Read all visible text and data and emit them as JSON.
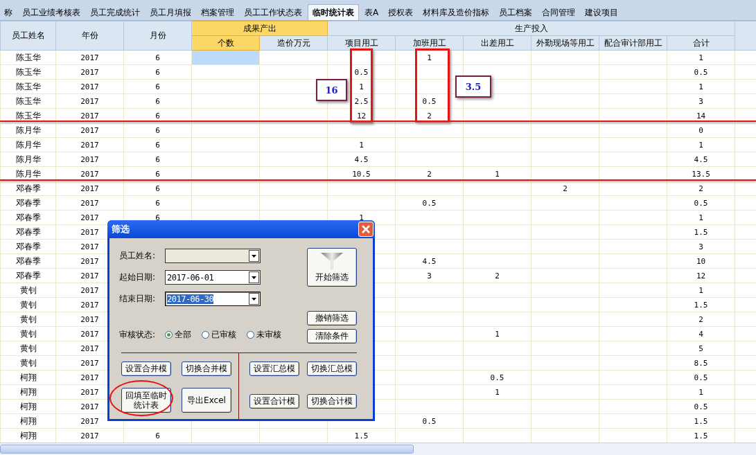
{
  "tabs": [
    {
      "label": "称",
      "selected": false
    },
    {
      "label": "员工业绩考核表",
      "selected": false
    },
    {
      "label": "员工完成统计",
      "selected": false
    },
    {
      "label": "员工月填报",
      "selected": false
    },
    {
      "label": "档案管理",
      "selected": false
    },
    {
      "label": "员工工作状态表",
      "selected": false
    },
    {
      "label": "临时统计表",
      "selected": true
    },
    {
      "label": "表A",
      "selected": false
    },
    {
      "label": "授权表",
      "selected": false
    },
    {
      "label": "材料库及造价指标",
      "selected": false
    },
    {
      "label": "员工档案",
      "selected": false
    },
    {
      "label": "合同管理",
      "selected": false
    },
    {
      "label": "建设项目",
      "selected": false
    }
  ],
  "table": {
    "groups": [
      {
        "label": "成果产出",
        "selected": true
      },
      {
        "label": "生产投入",
        "selected": false
      }
    ],
    "columns": [
      {
        "label": "员工姓名",
        "selected": false
      },
      {
        "label": "年份",
        "selected": false
      },
      {
        "label": "月份",
        "selected": false
      },
      {
        "label": "个数",
        "selected": true
      },
      {
        "label": "造价万元",
        "selected": false
      },
      {
        "label": "项目用工",
        "selected": false
      },
      {
        "label": "加班用工",
        "selected": false
      },
      {
        "label": "出差用工",
        "selected": false
      },
      {
        "label": "外勤现场等用工",
        "selected": false
      },
      {
        "label": "配合审计部用工",
        "selected": false
      },
      {
        "label": "合计",
        "selected": false
      }
    ],
    "rows": [
      {
        "selected": true,
        "cells": [
          "陈玉华",
          "2017",
          "6",
          null,
          null,
          null,
          "1",
          null,
          null,
          null,
          "1"
        ]
      },
      {
        "selected": false,
        "cells": [
          "陈玉华",
          "2017",
          "6",
          null,
          null,
          "0.5",
          null,
          null,
          null,
          null,
          "0.5"
        ]
      },
      {
        "selected": false,
        "cells": [
          "陈玉华",
          "2017",
          "6",
          null,
          null,
          "1",
          null,
          null,
          null,
          null,
          "1"
        ]
      },
      {
        "selected": false,
        "cells": [
          "陈玉华",
          "2017",
          "6",
          null,
          null,
          "2.5",
          "0.5",
          null,
          null,
          null,
          "3"
        ]
      },
      {
        "selected": false,
        "cells": [
          "陈玉华",
          "2017",
          "6",
          null,
          null,
          "12",
          "2",
          null,
          null,
          null,
          "14"
        ]
      },
      {
        "selected": false,
        "cells": [
          "陈月华",
          "2017",
          "6",
          null,
          null,
          null,
          null,
          null,
          null,
          null,
          "0"
        ]
      },
      {
        "selected": false,
        "cells": [
          "陈月华",
          "2017",
          "6",
          null,
          null,
          "1",
          null,
          null,
          null,
          null,
          "1"
        ]
      },
      {
        "selected": false,
        "cells": [
          "陈月华",
          "2017",
          "6",
          null,
          null,
          "4.5",
          null,
          null,
          null,
          null,
          "4.5"
        ]
      },
      {
        "selected": false,
        "cells": [
          "陈月华",
          "2017",
          "6",
          null,
          null,
          "10.5",
          "2",
          "1",
          null,
          null,
          "13.5"
        ]
      },
      {
        "selected": false,
        "cells": [
          "邓春季",
          "2017",
          "6",
          null,
          null,
          null,
          null,
          null,
          "2",
          null,
          "2"
        ]
      },
      {
        "selected": false,
        "cells": [
          "邓春季",
          "2017",
          "6",
          null,
          null,
          null,
          "0.5",
          null,
          null,
          null,
          "0.5"
        ]
      },
      {
        "selected": false,
        "cells": [
          "邓春季",
          "2017",
          "6",
          null,
          null,
          "1",
          null,
          null,
          null,
          null,
          "1"
        ]
      },
      {
        "selected": false,
        "cells": [
          "邓春季",
          "2017",
          null,
          null,
          null,
          null,
          null,
          null,
          null,
          null,
          "1.5"
        ]
      },
      {
        "selected": false,
        "cells": [
          "邓春季",
          "2017",
          null,
          null,
          null,
          null,
          null,
          null,
          null,
          null,
          "3"
        ]
      },
      {
        "selected": false,
        "cells": [
          "邓春季",
          "2017",
          null,
          null,
          null,
          null,
          "4.5",
          null,
          null,
          null,
          "10"
        ]
      },
      {
        "selected": false,
        "cells": [
          "邓春季",
          "2017",
          null,
          null,
          null,
          null,
          "3",
          "2",
          null,
          null,
          "12"
        ]
      },
      {
        "selected": false,
        "cells": [
          "黄钊",
          "2017",
          null,
          null,
          null,
          null,
          null,
          null,
          null,
          null,
          "1"
        ]
      },
      {
        "selected": false,
        "cells": [
          "黄钊",
          "2017",
          null,
          null,
          null,
          null,
          null,
          null,
          null,
          null,
          "1.5"
        ]
      },
      {
        "selected": false,
        "cells": [
          "黄钊",
          "2017",
          null,
          null,
          null,
          null,
          null,
          null,
          null,
          null,
          "2"
        ]
      },
      {
        "selected": false,
        "cells": [
          "黄钊",
          "2017",
          null,
          null,
          null,
          null,
          null,
          "1",
          null,
          null,
          "4"
        ]
      },
      {
        "selected": false,
        "cells": [
          "黄钊",
          "2017",
          null,
          null,
          null,
          null,
          null,
          null,
          null,
          null,
          "5"
        ]
      },
      {
        "selected": false,
        "cells": [
          "黄钊",
          "2017",
          null,
          null,
          null,
          null,
          null,
          null,
          null,
          null,
          "8.5"
        ]
      },
      {
        "selected": false,
        "cells": [
          "柯翔",
          "2017",
          null,
          null,
          null,
          null,
          null,
          "0.5",
          null,
          null,
          "0.5"
        ]
      },
      {
        "selected": false,
        "cells": [
          "柯翔",
          "2017",
          null,
          null,
          null,
          null,
          null,
          "1",
          null,
          null,
          "1"
        ]
      },
      {
        "selected": false,
        "cells": [
          "柯翔",
          "2017",
          null,
          null,
          null,
          null,
          null,
          null,
          null,
          null,
          "0.5"
        ]
      },
      {
        "selected": false,
        "cells": [
          "柯翔",
          "2017",
          null,
          null,
          null,
          null,
          "0.5",
          null,
          null,
          null,
          "1.5"
        ]
      },
      {
        "selected": false,
        "cells": [
          "柯翔",
          "2017",
          "6",
          null,
          null,
          "1.5",
          null,
          null,
          null,
          null,
          "1.5"
        ]
      }
    ]
  },
  "annotations": [
    {
      "kind": "box"
    },
    {
      "kind": "box"
    },
    {
      "kind": "callout",
      "text": "16"
    },
    {
      "kind": "callout",
      "text": "3.5"
    },
    {
      "kind": "underline"
    },
    {
      "kind": "underline"
    },
    {
      "kind": "circle"
    }
  ],
  "dialog": {
    "title": "筛选",
    "fields": [
      {
        "label": "员工姓名:",
        "selected": false
      },
      {
        "label": "起始日期:",
        "value": "2017-06-01",
        "selected": false
      },
      {
        "label": "结束日期:",
        "value": "2017-06-30",
        "selected": true
      }
    ],
    "status_filter": {
      "label": "审核状态:",
      "options": [
        {
          "label": "全部",
          "selected": true
        },
        {
          "label": "已审核",
          "selected": false
        },
        {
          "label": "未审核",
          "selected": false
        }
      ]
    },
    "start_button": "开始筛选",
    "side_buttons": [
      "撤销筛选",
      "清除条件"
    ],
    "left_buttons": [
      "设置合并模",
      "切换合并模",
      "回填至临时统计表",
      "导出Excel"
    ],
    "right_buttons": [
      "设置汇总模",
      "切换汇总模",
      "设置合计模",
      "切换合计模"
    ]
  }
}
